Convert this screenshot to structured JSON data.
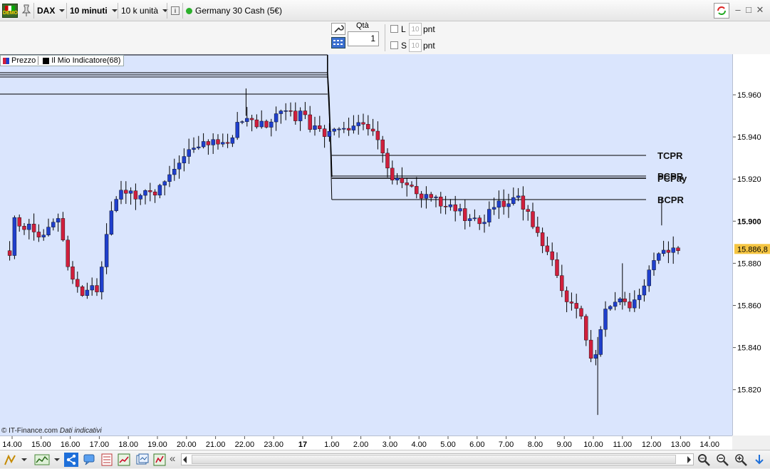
{
  "toolbar": {
    "demo_badge": "DEMO",
    "instrument": "DAX",
    "timeframe": "10 minuti",
    "units": "10 k unità",
    "info_icon": "i",
    "market_name": "Germany 30 Cash (5€)",
    "market_status_color": "#2bb02b"
  },
  "order_panel": {
    "qty_label": "Qtà",
    "qty_value": "1",
    "l_label": "L",
    "l_value": "10",
    "l_unit": "pnt",
    "s_label": "S",
    "s_value": "10",
    "s_unit": "pnt"
  },
  "legend": {
    "price_label": "Prezzo",
    "indicator_label": "Il Mio Indicatore(68)"
  },
  "watermark": {
    "copyright": "© IT-Finance.com",
    "note": "Dati indicativi"
  },
  "chart_data": {
    "type": "candlestick",
    "y_ticks": [
      "15.960",
      "15.940",
      "15.920",
      "15.900",
      "15.880",
      "15.860",
      "15.840",
      "15.820"
    ],
    "bold_y_tick": "15.900",
    "current_price": "15.886,8",
    "x_ticks": [
      "14.00",
      "15.00",
      "16.00",
      "17.00",
      "18.00",
      "19.00",
      "20.00",
      "21.00",
      "22.00",
      "23.00",
      "17",
      "1.00",
      "2.00",
      "3.00",
      "4.00",
      "5.00",
      "6.00",
      "7.00",
      "8.00",
      "9.00",
      "10.00",
      "11.00",
      "12.00",
      "13.00",
      "14.00"
    ],
    "bold_x_tick": "17",
    "ylim": [
      15805,
      15978
    ],
    "level_labels": {
      "tcpr": "TCPR",
      "pcpr": "PCPR",
      "pcpay": "PCPay",
      "bcpr": "BCPR"
    },
    "levels": {
      "tcpr": 15931,
      "pcpr": 15921,
      "pcpay": 15920,
      "bcpr": 15910
    },
    "prev_levels": [
      15978,
      15961,
      15970,
      15968
    ],
    "colors": {
      "up": "#1f3fcc",
      "down": "#d01f3c",
      "wick": "#000000",
      "background": "#dae5fd",
      "price_tag": "#f5c542"
    }
  }
}
